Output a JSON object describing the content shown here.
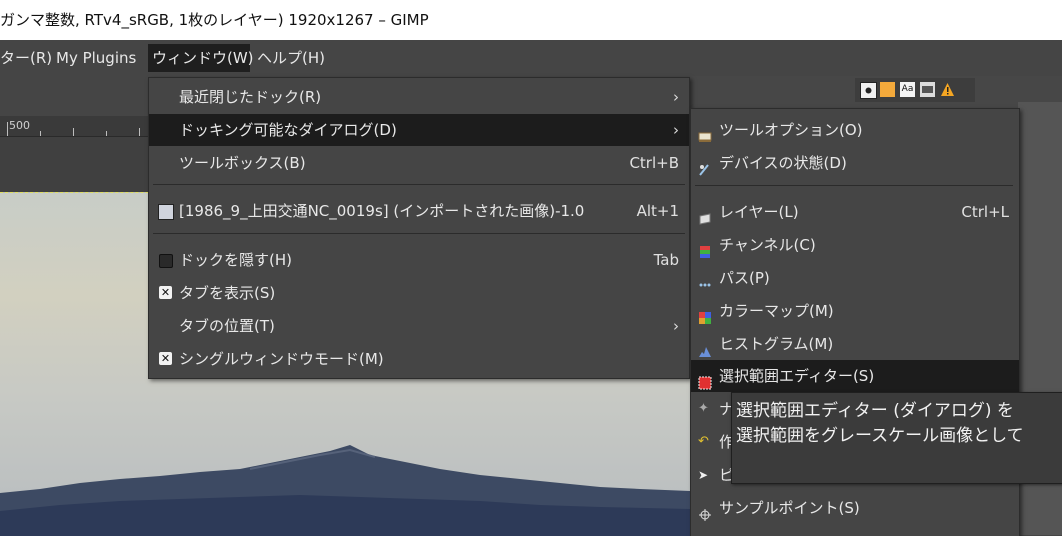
{
  "window": {
    "title": "ガンマ整数, RTv4_sRGB, 1枚のレイヤー) 1920x1267 – GIMP"
  },
  "menubar": {
    "items": [
      {
        "label": "ター(R)"
      },
      {
        "label": "My Plugins"
      },
      {
        "label": "ウィンドウ(W)"
      },
      {
        "label": "ヘルプ(H)"
      }
    ]
  },
  "ruler": {
    "label": "500"
  },
  "dock_tabs": {
    "icons": [
      "pointer-icon",
      "patterns-icon",
      "fonts-icon",
      "document-history-icon",
      "warning-icon"
    ]
  },
  "window_menu": {
    "items": [
      {
        "label": "最近閉じたドック(R)",
        "submenu": true
      },
      {
        "label": "ドッキング可能なダイアログ(D)",
        "submenu": true
      },
      {
        "label": "ツールボックス(B)",
        "accel": "Ctrl+B"
      },
      {
        "label": "[1986_9_上田交通NC_0019s] (インポートされた画像)-1.0",
        "accel": "Alt+1"
      },
      {
        "label": "ドックを隠す(H)",
        "accel": "Tab"
      },
      {
        "label": "タブを表示(S)"
      },
      {
        "label": "タブの位置(T)",
        "submenu": true
      },
      {
        "label": "シングルウィンドウモード(M)"
      }
    ]
  },
  "dockable_menu": {
    "items": [
      {
        "label": "ツールオプション(O)",
        "icon": "tool-options-icon"
      },
      {
        "label": "デバイスの状態(D)",
        "icon": "device-status-icon"
      },
      {
        "label": "レイヤー(L)",
        "accel": "Ctrl+L",
        "icon": "layers-icon"
      },
      {
        "label": "チャンネル(C)",
        "icon": "channels-icon"
      },
      {
        "label": "パス(P)",
        "icon": "paths-icon"
      },
      {
        "label": "カラーマップ(M)",
        "icon": "colormap-icon"
      },
      {
        "label": "ヒストグラム(M)",
        "icon": "histogram-icon"
      },
      {
        "label": "選択範囲エディター(S)",
        "icon": "selection-editor-icon"
      },
      {
        "label": "ナ",
        "icon": "navigation-icon"
      },
      {
        "label": "作",
        "icon": "undo-history-icon"
      },
      {
        "label": "ピ",
        "icon": "pointer-icon"
      },
      {
        "label": "サンプルポイント(S)",
        "icon": "sample-points-icon"
      }
    ]
  },
  "tooltip": {
    "lines": [
      "選択範囲エディター (ダイアログ) を",
      "選択範囲をグレースケール画像として"
    ]
  }
}
